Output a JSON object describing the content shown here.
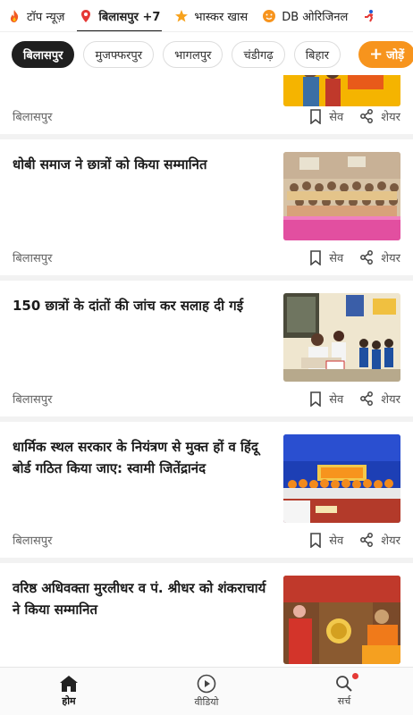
{
  "top_tabs": [
    {
      "label": "टॉप न्यूज़",
      "icon": "flame-icon"
    },
    {
      "label": "बिलासपुर +7",
      "icon": "location-pin-icon",
      "active": true
    },
    {
      "label": "भास्कर खास",
      "icon": "star-icon"
    },
    {
      "label": "DB ओरिजिनल",
      "icon": "smiley-icon"
    }
  ],
  "chips": [
    "बिलासपुर",
    "मुजफ्फरपुर",
    "भागलपुर",
    "चंडीगढ़",
    "बिहार"
  ],
  "add_chip": {
    "label": "जोड़ें"
  },
  "actions": {
    "save": "सेव",
    "share": "शेयर"
  },
  "articles": [
    {
      "title": "",
      "city": "बिलासपुर"
    },
    {
      "title": "धोबी समाज ने छात्रों को किया सम्मानित",
      "city": "बिलासपुर"
    },
    {
      "title": "150 छात्रों के दांतों की जांच कर सलाह दी गई",
      "city": "बिलासपुर"
    },
    {
      "title": "धार्मिक स्थल सरकार के नियंत्रण से मुक्त हों व हिंदू बोर्ड गठित किया जाए: स्वामी जितेंद्रानंद",
      "city": "बिलासपुर"
    },
    {
      "title": "वरिष्ठ अधिवक्ता मुरलीधर व पं. श्रीधर को शंकराचार्य ने किया सम्मानित",
      "city": ""
    }
  ],
  "bottom_nav": [
    {
      "label": "होम",
      "icon": "home-icon",
      "active": true
    },
    {
      "label": "वीडियो",
      "icon": "play-icon"
    },
    {
      "label": "सर्च",
      "icon": "search-icon"
    }
  ],
  "colors": {
    "accent": "#f7941d",
    "notify": "#e53935",
    "dark": "#1f1f1f"
  }
}
